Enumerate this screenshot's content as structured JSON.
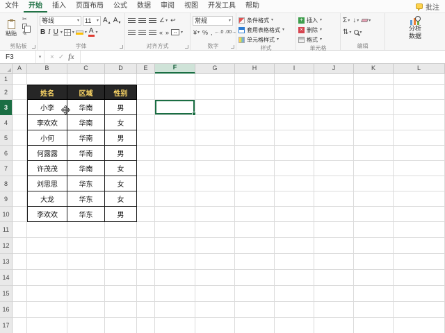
{
  "colors": {
    "excel_green": "#217346",
    "selection_green": "#1a6e43",
    "table_header_bg": "#262626",
    "table_header_text": "#ffd966"
  },
  "tabs": {
    "items": [
      {
        "id": "file",
        "label": "文件",
        "active": false
      },
      {
        "id": "home",
        "label": "开始",
        "active": true
      },
      {
        "id": "insert",
        "label": "插入",
        "active": false
      },
      {
        "id": "page-layout",
        "label": "页面布局",
        "active": false
      },
      {
        "id": "formulas",
        "label": "公式",
        "active": false
      },
      {
        "id": "data",
        "label": "数据",
        "active": false
      },
      {
        "id": "review",
        "label": "审阅",
        "active": false
      },
      {
        "id": "view",
        "label": "视图",
        "active": false
      },
      {
        "id": "developer",
        "label": "开发工具",
        "active": false
      },
      {
        "id": "help",
        "label": "帮助",
        "active": false
      }
    ],
    "comments_label": "批注"
  },
  "ribbon": {
    "clipboard": {
      "label": "剪贴板",
      "paste": "粘贴"
    },
    "font": {
      "label": "字体",
      "font_name": "等线",
      "font_size": "11"
    },
    "alignment": {
      "label": "对齐方式"
    },
    "number": {
      "label": "数字",
      "format": "常规"
    },
    "styles": {
      "label": "样式",
      "buttons": [
        "条件格式",
        "套用表格格式",
        "单元格样式"
      ]
    },
    "cells": {
      "label": "单元格",
      "buttons": [
        "插入",
        "删除",
        "格式"
      ]
    },
    "editing": {
      "label": "编辑"
    },
    "analyze": {
      "line1": "分析",
      "line2": "数据"
    }
  },
  "formula_bar": {
    "name_box": "F3",
    "fx_label": "fx",
    "value": ""
  },
  "grid": {
    "columns": [
      "A",
      "B",
      "C",
      "D",
      "E",
      "F",
      "G",
      "H",
      "I",
      "J",
      "K",
      "L"
    ],
    "rows": [
      "1",
      "2",
      "3",
      "4",
      "5",
      "6",
      "7",
      "8",
      "9",
      "10",
      "11",
      "12",
      "13",
      "14",
      "15",
      "16",
      "17"
    ],
    "selection": {
      "cell": "F3",
      "column": "F",
      "row": "3"
    }
  },
  "table": {
    "headers": [
      "姓名",
      "区域",
      "性别"
    ],
    "rows": [
      [
        "小李",
        "华南",
        "男"
      ],
      [
        "李欢欢",
        "华南",
        "女"
      ],
      [
        "小何",
        "华南",
        "男"
      ],
      [
        "何露露",
        "华南",
        "男"
      ],
      [
        "许茂茂",
        "华南",
        "女"
      ],
      [
        "刘思思",
        "华东",
        "女"
      ],
      [
        "大龙",
        "华东",
        "女"
      ],
      [
        "李欢欢",
        "华东",
        "男"
      ]
    ]
  }
}
